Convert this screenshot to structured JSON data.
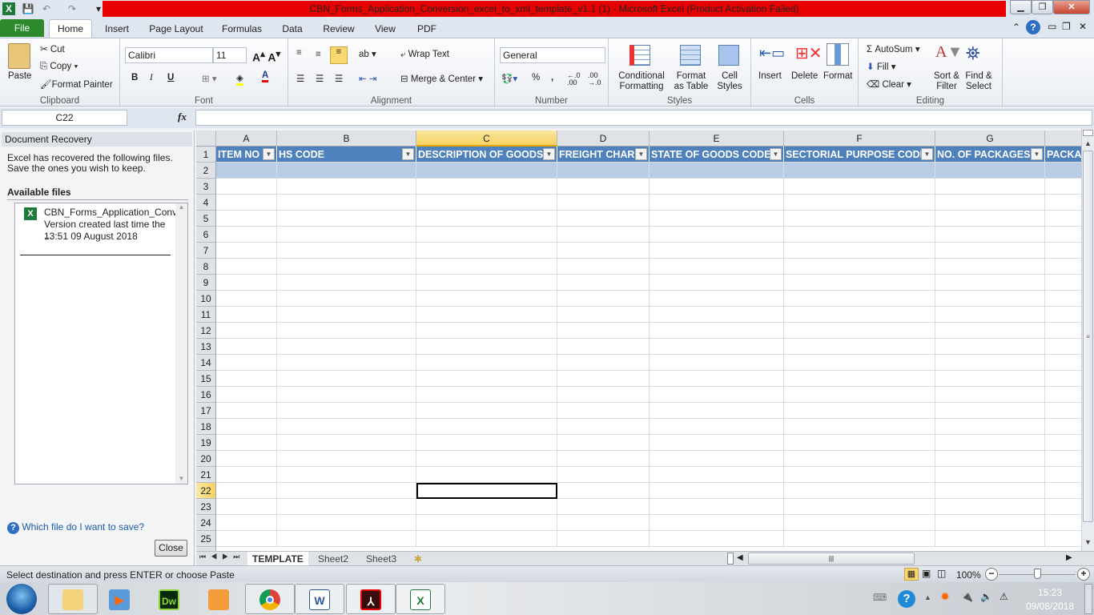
{
  "window": {
    "title": "CBN_Forms_Application_Conversion_excel_to_xml_template_v1.1 (1)  -  Microsoft Excel (Product Activation Failed)",
    "title_color": "#e80000"
  },
  "ribbon_tabs": [
    "File",
    "Home",
    "Insert",
    "Page Layout",
    "Formulas",
    "Data",
    "Review",
    "View",
    "PDF"
  ],
  "clipboard": {
    "paste": "Paste",
    "cut": "Cut",
    "copy": "Copy",
    "format_painter": "Format Painter",
    "label": "Clipboard"
  },
  "font": {
    "name": "Calibri",
    "size": "11",
    "bold": "B",
    "italic": "I",
    "underline": "U",
    "label": "Font"
  },
  "alignment": {
    "wrap": "Wrap Text",
    "merge": "Merge & Center",
    "label": "Alignment"
  },
  "number": {
    "format": "General",
    "percent": "%",
    "comma": ",",
    "inc": "←.0 .00",
    "dec": ".00 →.0",
    "label": "Number"
  },
  "styles": {
    "conditional": "Conditional Formatting",
    "format_table": "Format as Table",
    "cell_styles": "Cell Styles",
    "label": "Styles"
  },
  "cells": {
    "insert": "Insert",
    "delete": "Delete",
    "format": "Format",
    "label": "Cells"
  },
  "editing": {
    "autosum": "AutoSum",
    "fill": "Fill",
    "clear": "Clear",
    "sort": "Sort & Filter",
    "find": "Find & Select",
    "label": "Editing"
  },
  "formula_bar": {
    "name_box": "C22",
    "fx": "fx",
    "value": ""
  },
  "recovery": {
    "title": "Document Recovery",
    "message": "Excel has recovered the following files.  Save the ones you wish to keep.",
    "available": "Available files",
    "file_name": "CBN_Forms_Application_Conv...",
    "file_desc": "Version created last time the ...",
    "file_time": "13:51 09 August 2018",
    "help": "Which file do I want to save?",
    "close": "Close"
  },
  "sheet": {
    "columns": [
      "A",
      "B",
      "C",
      "D",
      "E",
      "F",
      "G",
      ""
    ],
    "headers": [
      "ITEM NO",
      "HS CODE",
      "DESCRIPTION OF GOODS",
      "FREIGHT CHARG",
      "STATE OF GOODS CODE",
      "SECTORIAL PURPOSE CODE",
      "NO. OF PACKAGES",
      "PACKA"
    ],
    "rows": [
      "1",
      "2",
      "3",
      "4",
      "5",
      "6",
      "7",
      "8",
      "9",
      "10",
      "11",
      "12",
      "13",
      "14",
      "15",
      "16",
      "17",
      "18",
      "19",
      "20",
      "21",
      "22",
      "23",
      "24",
      "25"
    ],
    "selected_cell": "C22",
    "header_color": "#4f81bd",
    "band_color": "#b8cce4"
  },
  "sheet_tabs": [
    "TEMPLATE",
    "Sheet2",
    "Sheet3"
  ],
  "status": {
    "message": "Select destination and press ENTER or choose Paste",
    "zoom": "100%",
    "zoom_level": 100
  },
  "taskbar": {
    "apps": [
      "explorer",
      "media-player",
      "dreamweaver",
      "photo-viewer",
      "chrome",
      "word",
      "acrobat",
      "excel"
    ],
    "time": "15:23",
    "date": "09/08/2018"
  }
}
